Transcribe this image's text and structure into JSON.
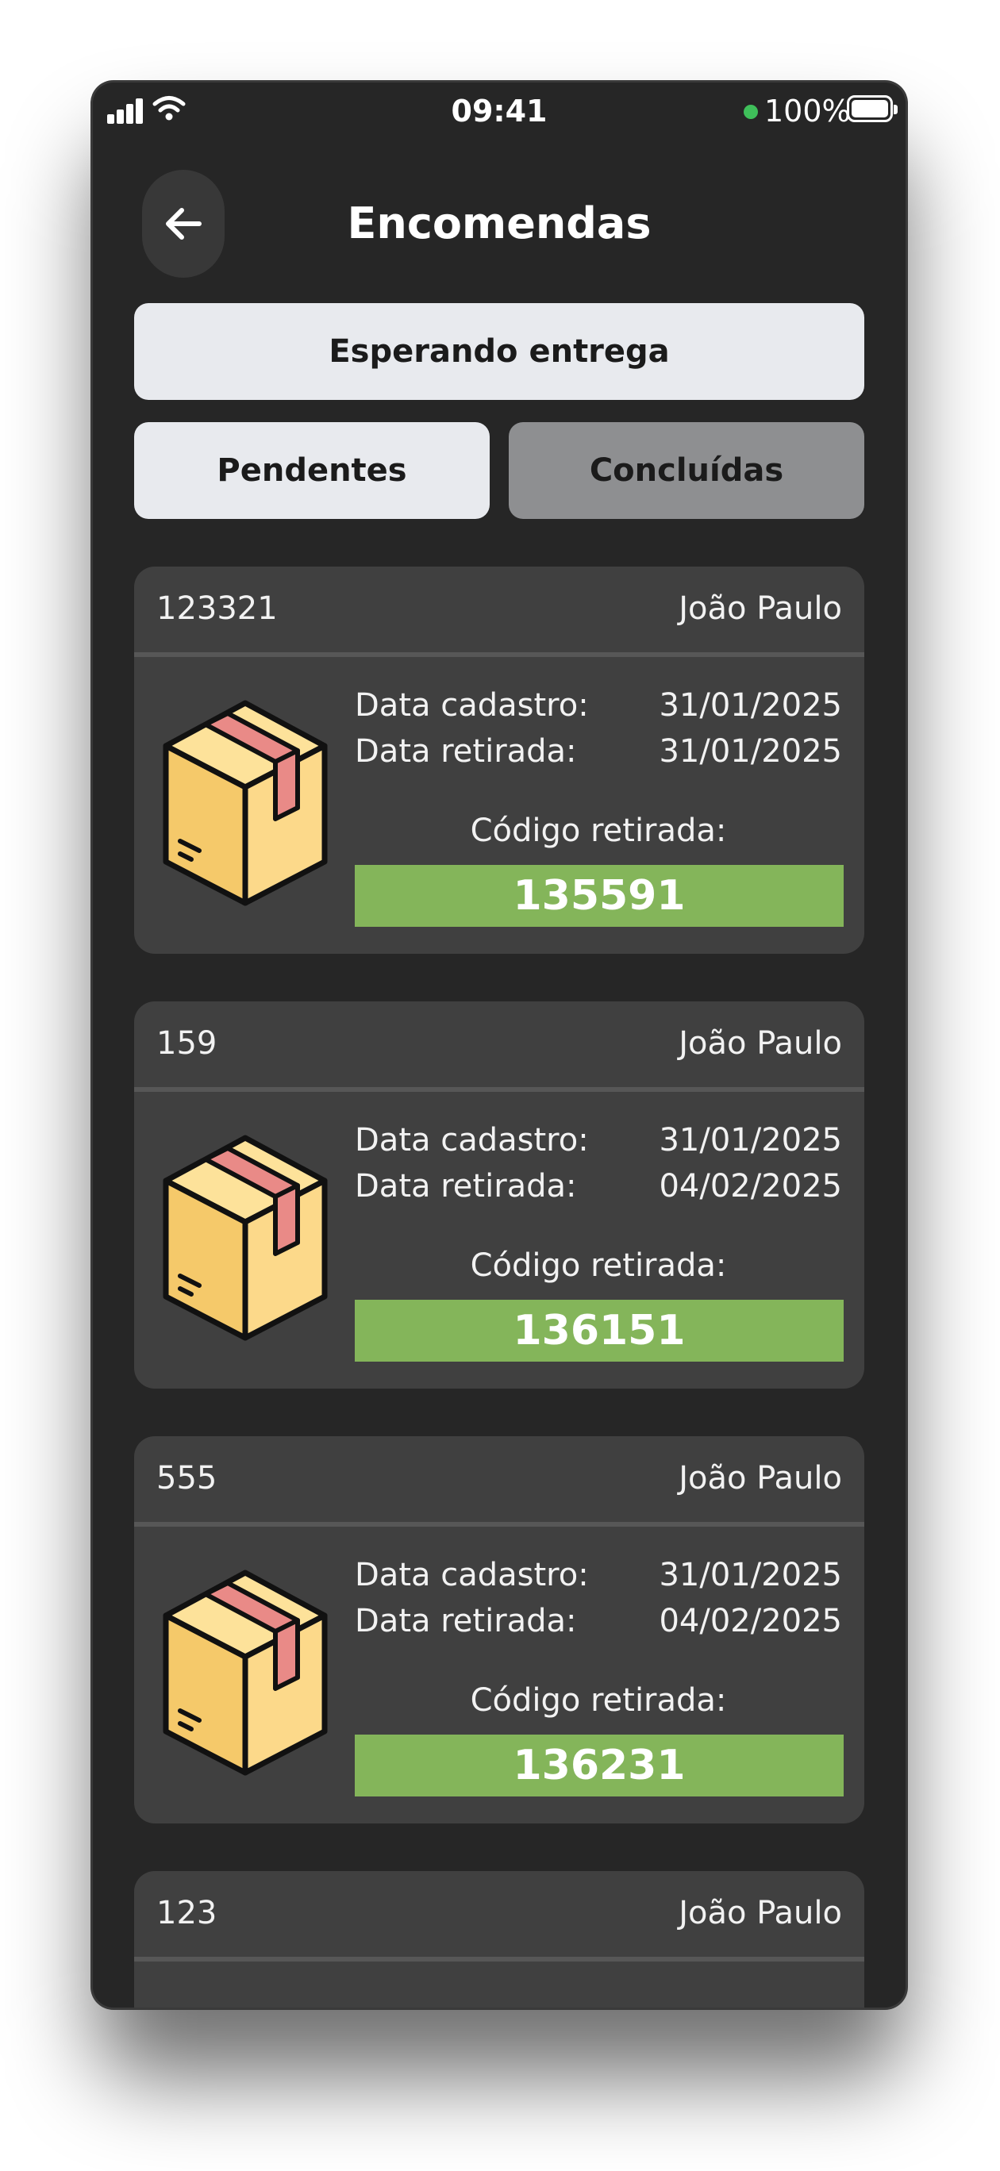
{
  "status_bar": {
    "time": "09:41",
    "battery": "100%"
  },
  "header": {
    "title": "Encomendas"
  },
  "status_filter": {
    "label": "Esperando entrega"
  },
  "tabs": [
    {
      "label": "Pendentes",
      "active": true
    },
    {
      "label": "Concluídas",
      "active": false
    }
  ],
  "labels": {
    "data_cadastro": "Data cadastro:",
    "data_retirada": "Data retirada:",
    "codigo_retirada": "Código retirada:"
  },
  "orders": [
    {
      "id": "123321",
      "name": "João Paulo",
      "data_cadastro": "31/01/2025",
      "data_retirada": "31/01/2025",
      "codigo": "135591"
    },
    {
      "id": "159",
      "name": "João Paulo",
      "data_cadastro": "31/01/2025",
      "data_retirada": "04/02/2025",
      "codigo": "136151"
    },
    {
      "id": "555",
      "name": "João Paulo",
      "data_cadastro": "31/01/2025",
      "data_retirada": "04/02/2025",
      "codigo": "136231"
    },
    {
      "id": "123",
      "name": "João Paulo"
    }
  ],
  "colors": {
    "background": "#262626",
    "card": "#404040",
    "code_bg": "#84b55a",
    "pill_active": "#e8eaee",
    "pill_inactive": "#8e8f91"
  }
}
